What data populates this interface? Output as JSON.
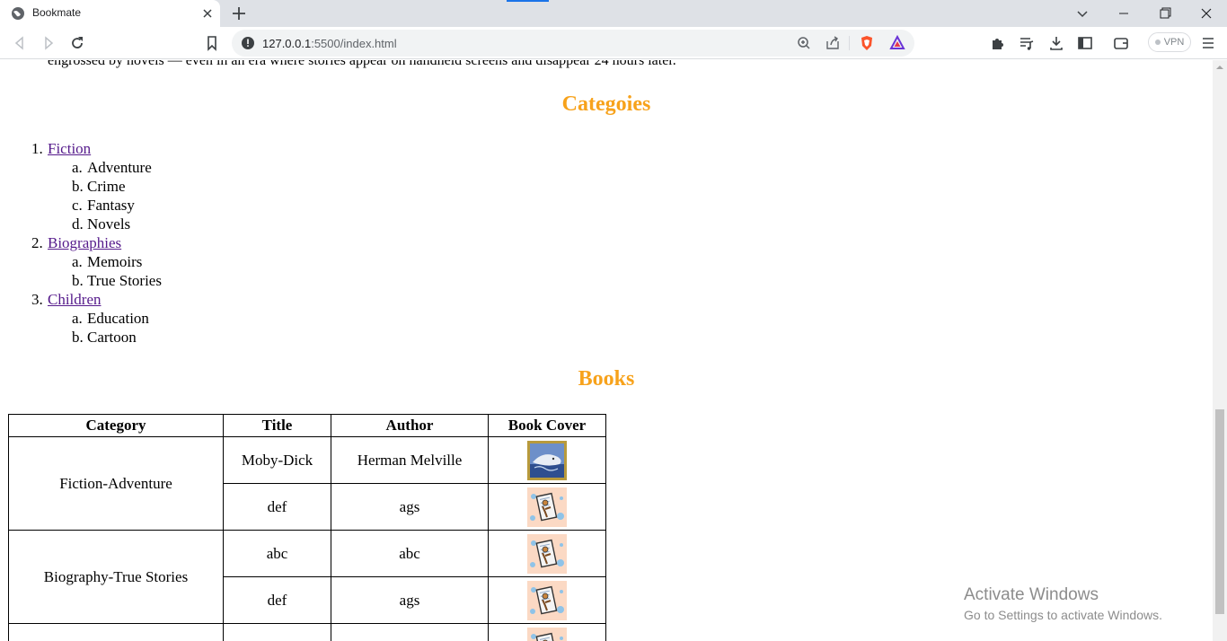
{
  "browser": {
    "tab_title": "Bookmate",
    "url_host": "127.0.0.1",
    "url_rest": ":5500/index.html",
    "vpn_label": "VPN"
  },
  "page": {
    "intro_text": "engrossed by novels — even in an era where stories appear on handheld screens and disappear 24 hours later.",
    "categories_heading": "Categoies",
    "books_heading": "Books",
    "heading_color": "#f7a21b",
    "categories": [
      {
        "num": "1.",
        "label": "Fiction",
        "subs": [
          {
            "letter": "a.",
            "label": "Adventure"
          },
          {
            "letter": "b.",
            "label": "Crime"
          },
          {
            "letter": "c.",
            "label": "Fantasy"
          },
          {
            "letter": "d.",
            "label": "Novels"
          }
        ]
      },
      {
        "num": "2.",
        "label": "Biographies",
        "subs": [
          {
            "letter": "a.",
            "label": "Memoirs"
          },
          {
            "letter": "b.",
            "label": "True Stories"
          }
        ]
      },
      {
        "num": "3.",
        "label": "Children",
        "subs": [
          {
            "letter": "a.",
            "label": "Education"
          },
          {
            "letter": "b.",
            "label": "Cartoon"
          }
        ]
      }
    ],
    "table": {
      "headers": [
        "Category",
        "Title",
        "Author",
        "Book Cover"
      ],
      "groups": [
        {
          "category": "Fiction-Adventure",
          "rows": [
            {
              "title": "Moby-Dick",
              "author": "Herman Melville",
              "cover": "moby-dick-cover"
            },
            {
              "title": "def",
              "author": "ags",
              "cover": "placeholder-cover"
            }
          ]
        },
        {
          "category": "Biography-True Stories",
          "rows": [
            {
              "title": "abc",
              "author": "abc",
              "cover": "placeholder-cover"
            },
            {
              "title": "def",
              "author": "ags",
              "cover": "placeholder-cover"
            }
          ]
        },
        {
          "category": "",
          "rows": [
            {
              "title": "",
              "author": "",
              "cover": "placeholder-cover"
            }
          ]
        }
      ]
    }
  },
  "watermark": {
    "title": "Activate Windows",
    "subtitle": "Go to Settings to activate Windows."
  }
}
